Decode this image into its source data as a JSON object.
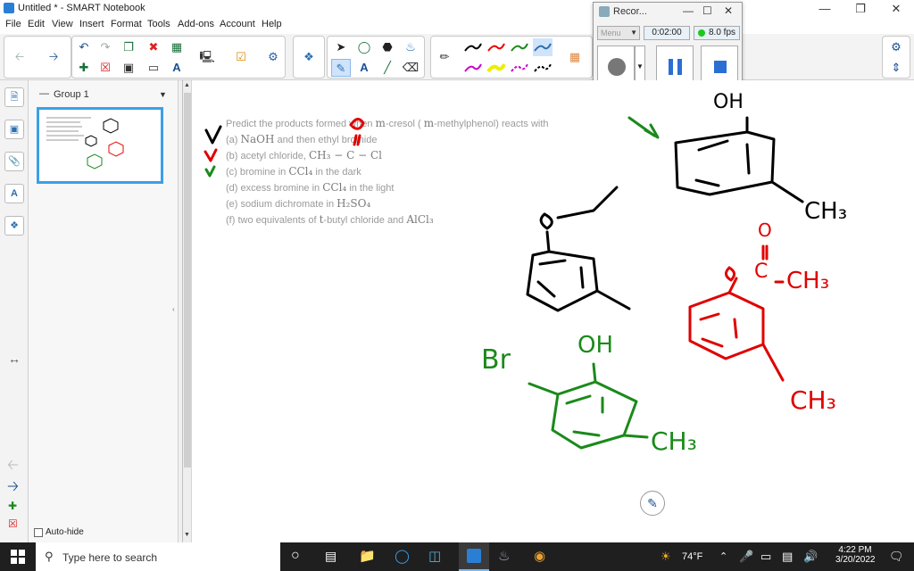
{
  "window": {
    "title": "Untitled * - SMART Notebook"
  },
  "menu": [
    "File",
    "Edit",
    "View",
    "Insert",
    "Format",
    "Tools",
    "Add-ons",
    "Account",
    "Help"
  ],
  "recorder": {
    "title": "Recor...",
    "mode": "Menu",
    "time": "0:02:00",
    "fps": "8.0 fps"
  },
  "sidebar": {
    "group_label": "Group 1",
    "auto_hide": "Auto-hide"
  },
  "question": {
    "intro": "Predict the products formed when",
    "intro_m": "m",
    "intro_mid": "-cresol (",
    "intro_m2": "m",
    "intro_end": "-methylphenol) reacts with",
    "items": [
      {
        "label": "(a)",
        "text": "NaOH",
        "rest": "and then ethyl bromide"
      },
      {
        "label": "(b)",
        "text": "acetyl chloride,",
        "rest": "CH₃ − C − Cl"
      },
      {
        "label": "(c)",
        "text": "bromine in",
        "rest": "CCl₄",
        "tail": "in the dark"
      },
      {
        "label": "(d)",
        "text": "excess bromine in",
        "rest": "CCl₄",
        "tail": "in the light"
      },
      {
        "label": "(e)",
        "text": "sodium dichromate in",
        "rest": "H₂SO₄"
      },
      {
        "label": "(f)",
        "text": "two equivalents of",
        "rest": "t",
        "tail": "-butyl chloride and",
        "tail2": "AlCl₃"
      }
    ]
  },
  "annotations": {
    "oh_top": "OH",
    "ch3_top": "CH₃",
    "o_red": "O",
    "o_ester": "O",
    "c_ester": "C",
    "ch3_ester": "CH₃",
    "ch3_red": "CH₃",
    "br_green": "Br",
    "oh_green": "OH",
    "ch3_green": "CH₃"
  },
  "colors": {
    "red": "#e00000",
    "green": "#1a8a1a",
    "black": "#000000",
    "accent": "#2a7fd4"
  },
  "taskbar": {
    "search_placeholder": "Type here to search",
    "weather": "74°F",
    "time": "4:22 PM",
    "date": "3/20/2022"
  }
}
